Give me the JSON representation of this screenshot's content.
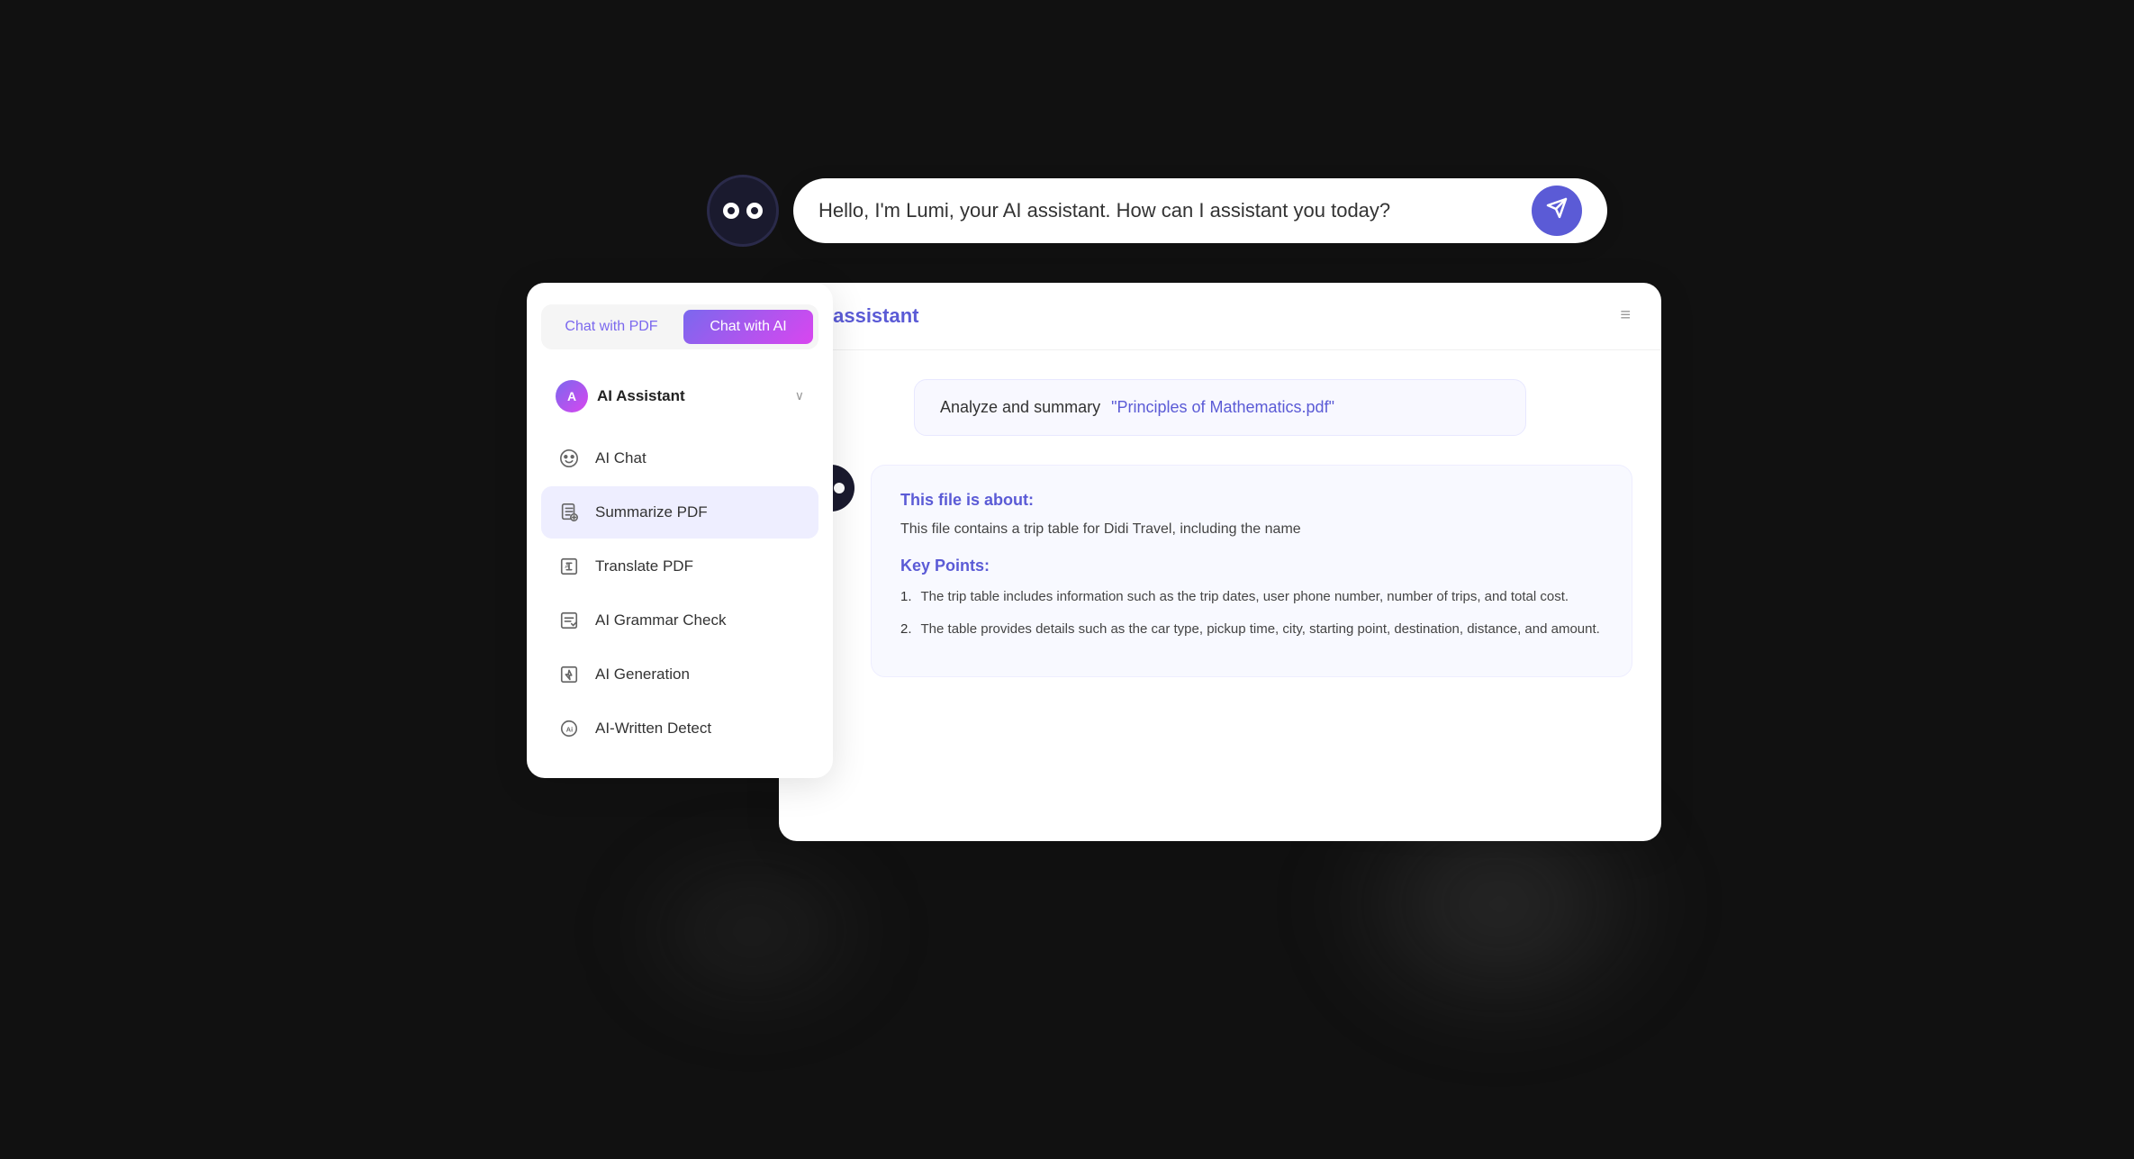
{
  "topBar": {
    "inputPlaceholder": "Hello, I'm Lumi, your AI assistant. How can I assistant you today?",
    "sendLabel": "➤"
  },
  "tabs": {
    "chatWithPDF": "Chat with PDF",
    "chatWithAI": "Chat with AI"
  },
  "sidebar": {
    "assistantName": "AI Assistant",
    "assistantInitial": "A",
    "items": [
      {
        "id": "ai-chat",
        "label": "AI Chat",
        "icon": "🤖"
      },
      {
        "id": "summarize-pdf",
        "label": "Summarize PDF",
        "icon": "📄"
      },
      {
        "id": "translate-pdf",
        "label": "Translate PDF",
        "icon": "🔤"
      },
      {
        "id": "grammar-check",
        "label": "AI Grammar Check",
        "icon": "✅"
      },
      {
        "id": "ai-generation",
        "label": "AI Generation",
        "icon": "⚡"
      },
      {
        "id": "ai-written-detect",
        "label": "AI-Written Detect",
        "icon": "🔍"
      }
    ]
  },
  "mainPanel": {
    "title": "AI assistant",
    "analyzePrompt": {
      "prefix": "Analyze and summary",
      "file": "\"Principles of Mathematics.pdf\""
    },
    "response": {
      "fileAboutTitle": "This file is about:",
      "fileAboutText": "This file contains a trip table for Didi Travel, including the name",
      "keyPointsTitle": "Key Points:",
      "keyPoints": [
        "The trip table includes information such as the trip dates, user phone number, number of trips, and total cost.",
        "The table provides details such as the car type, pickup time, city, starting point, destination, distance, and amount."
      ]
    }
  }
}
